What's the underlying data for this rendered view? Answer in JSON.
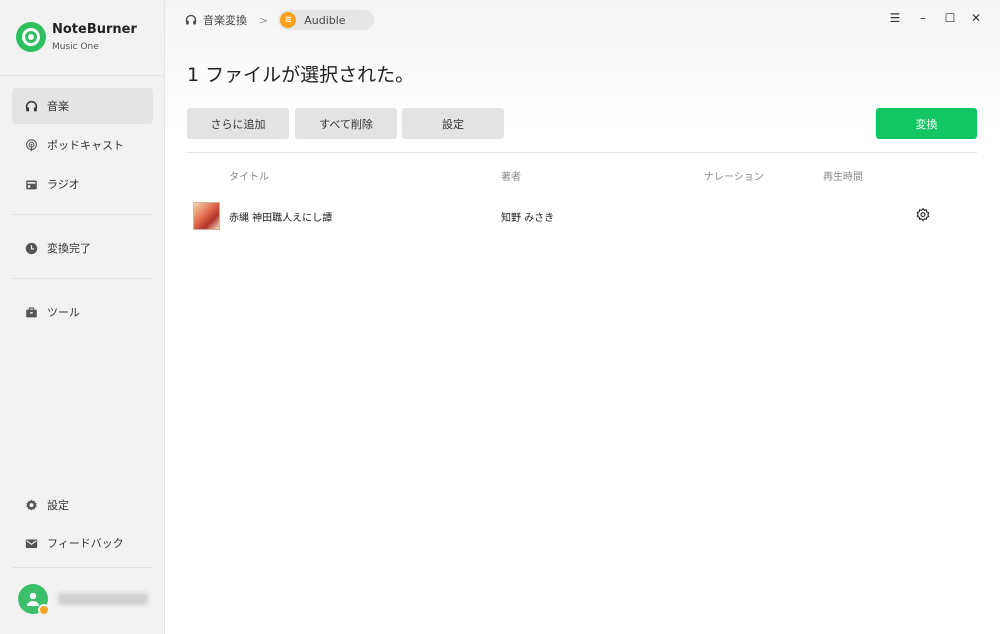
{
  "app": {
    "name": "NoteBurner",
    "subtitle": "Music One",
    "accent_color": "#13c664"
  },
  "sidebar": {
    "items": [
      {
        "label": "音楽",
        "icon": "headphones-icon",
        "active": true
      },
      {
        "label": "ポッドキャスト",
        "icon": "podcast-icon",
        "active": false
      },
      {
        "label": "ラジオ",
        "icon": "radio-icon",
        "active": false
      },
      {
        "label": "変換完了",
        "icon": "clock-icon",
        "active": false
      },
      {
        "label": "ツール",
        "icon": "toolbox-icon",
        "active": false
      },
      {
        "label": "設定",
        "icon": "gear-icon",
        "active": false
      },
      {
        "label": "フィードバック",
        "icon": "mail-icon",
        "active": false
      }
    ]
  },
  "breadcrumb": {
    "section": "音楽変換",
    "source": "Audible"
  },
  "header": {
    "heading": "1 ファイルが選択された。"
  },
  "toolbar": {
    "add_more": "さらに追加",
    "delete_all": "すべて削除",
    "settings": "設定",
    "convert": "変換"
  },
  "table": {
    "columns": [
      "タイトル",
      "著者",
      "ナレーション",
      "再生時間"
    ],
    "rows": [
      {
        "title": "赤縄 神田職人えにし譚",
        "author": "知野 みさき",
        "narration": "",
        "duration": ""
      }
    ]
  }
}
